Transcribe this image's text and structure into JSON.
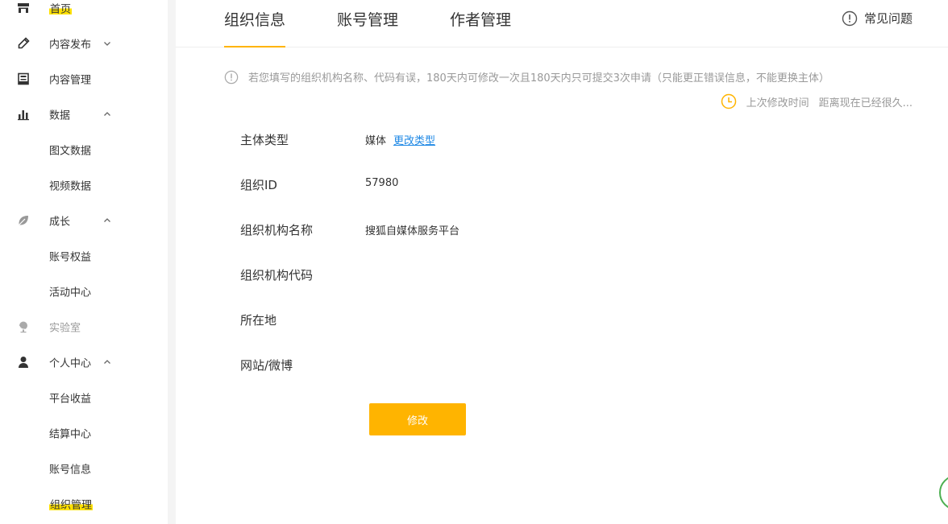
{
  "sidebar": {
    "items": [
      {
        "name": "home",
        "label": "首页",
        "icon": "home-icon",
        "highlight": true
      },
      {
        "name": "publish",
        "label": "内容发布",
        "icon": "pencil-icon",
        "chevron": "down"
      },
      {
        "name": "content-manage",
        "label": "内容管理",
        "icon": "document-icon"
      },
      {
        "name": "data",
        "label": "数据",
        "icon": "bar-chart-icon",
        "chevron": "up"
      },
      {
        "name": "article-data",
        "label": "图文数据"
      },
      {
        "name": "video-data",
        "label": "视频数据"
      },
      {
        "name": "growth",
        "label": "成长",
        "icon": "leaf-icon",
        "chevron": "up"
      },
      {
        "name": "account-rights",
        "label": "账号权益"
      },
      {
        "name": "activity-center",
        "label": "活动中心"
      },
      {
        "name": "lab",
        "label": "实验室",
        "icon": "globe-icon",
        "disabled": true
      },
      {
        "name": "personal-center",
        "label": "个人中心",
        "icon": "user-icon",
        "chevron": "up"
      },
      {
        "name": "platform-income",
        "label": "平台收益"
      },
      {
        "name": "settlement-center",
        "label": "结算中心"
      },
      {
        "name": "account-info",
        "label": "账号信息"
      },
      {
        "name": "org-manage",
        "label": "组织管理",
        "highlight": true
      }
    ]
  },
  "tabs": [
    {
      "label": "组织信息",
      "active": true
    },
    {
      "label": "账号管理",
      "active": false
    },
    {
      "label": "作者管理",
      "active": false
    }
  ],
  "faq": {
    "label": "常见问题",
    "icon": "info-circle-icon"
  },
  "notice": {
    "text": "若您填写的组织机构名称、代码有误，180天内可修改一次且180天内只可提交3次申请（只能更正错误信息，不能更换主体）",
    "icon": "info-circle-icon"
  },
  "last_modified": {
    "label": "上次修改时间",
    "value": "距离现在已经很久...",
    "icon": "clock-icon"
  },
  "fields": {
    "entity_type": {
      "label": "主体类型",
      "value": "媒体",
      "link": "更改类型"
    },
    "org_id": {
      "label": "组织ID",
      "value": "57980"
    },
    "org_name": {
      "label": "组织机构名称",
      "value": "搜狐自媒体服务平台"
    },
    "org_code": {
      "label": "组织机构代码",
      "value": ""
    },
    "location": {
      "label": "所在地",
      "value": ""
    },
    "website": {
      "label": "网站/微博",
      "value": ""
    }
  },
  "edit_button": {
    "label": "修改"
  },
  "colors": {
    "accent": "#ffb400",
    "link": "#1e88e5",
    "highlight": "#ffe100",
    "muted": "#999999"
  }
}
